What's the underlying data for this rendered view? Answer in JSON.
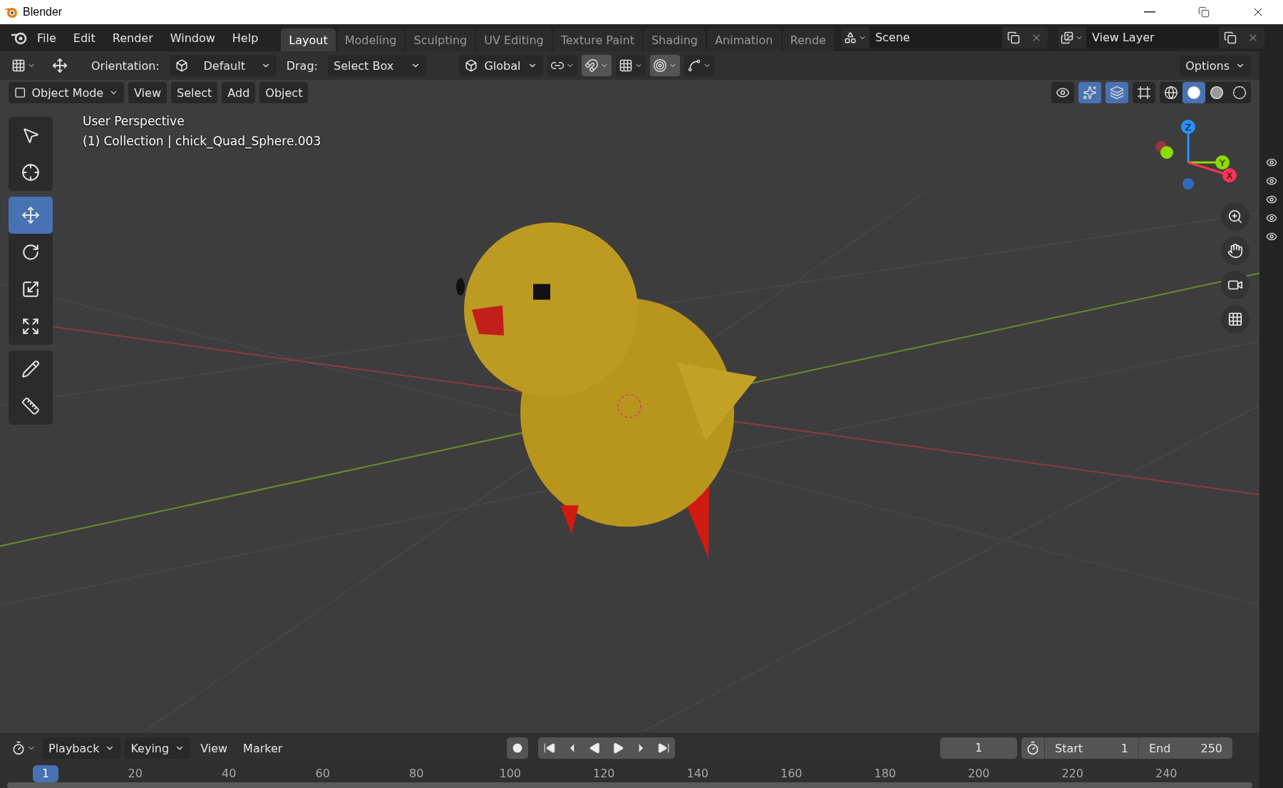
{
  "app_title": "Blender",
  "window_controls": [
    {
      "kind": "minimize"
    },
    {
      "kind": "restore"
    },
    {
      "kind": "close"
    }
  ],
  "menu": [
    "File",
    "Edit",
    "Render",
    "Window",
    "Help"
  ],
  "workspaces": [
    {
      "label": "Layout",
      "selected": true
    },
    {
      "label": "Modeling",
      "selected": false
    },
    {
      "label": "Sculpting",
      "selected": false
    },
    {
      "label": "UV Editing",
      "selected": false
    },
    {
      "label": "Texture Paint",
      "selected": false
    },
    {
      "label": "Shading",
      "selected": false
    },
    {
      "label": "Animation",
      "selected": false
    },
    {
      "label": "Rende",
      "selected": false
    }
  ],
  "scene": {
    "value": "Scene"
  },
  "view_layer": {
    "value": "View Layer"
  },
  "tool_header": {
    "orientation_label": "Orientation:",
    "orientation": "Default",
    "drag_label": "Drag:",
    "drag": "Select Box",
    "transform": "Global",
    "options": "Options",
    "toggles": [
      {
        "kind": "pivot",
        "on": false
      },
      {
        "kind": "snap",
        "on": true
      },
      {
        "kind": "snap-target",
        "on": false
      },
      {
        "kind": "proportional",
        "on": true
      },
      {
        "kind": "falloff",
        "on": false
      }
    ]
  },
  "viewport_header": {
    "mode": "Object Mode",
    "menus": [
      "View",
      "Select",
      "Add",
      "Object"
    ],
    "toggles": [
      {
        "kind": "visibility",
        "on": false
      },
      {
        "kind": "gizmo",
        "on": true
      },
      {
        "kind": "overlay",
        "on": true
      },
      {
        "kind": "xray",
        "on": false
      }
    ],
    "shading": [
      {
        "kind": "wireframe",
        "selected": false
      },
      {
        "kind": "solid",
        "selected": true
      },
      {
        "kind": "material",
        "selected": false
      },
      {
        "kind": "rendered",
        "selected": false
      }
    ]
  },
  "tools": [
    [
      {
        "kind": "select-box",
        "selected": false
      },
      {
        "kind": "cursor",
        "selected": false
      }
    ],
    [
      {
        "kind": "move",
        "selected": true
      },
      {
        "kind": "rotate",
        "selected": false
      },
      {
        "kind": "scale",
        "selected": false
      },
      {
        "kind": "transform",
        "selected": false
      }
    ],
    [
      {
        "kind": "annotate",
        "selected": false
      },
      {
        "kind": "measure",
        "selected": false
      }
    ]
  ],
  "viewport": {
    "view_name": "User Perspective",
    "object_info": "(1) Collection | chick_Quad_Sphere.003"
  },
  "gizmo": {
    "axes": [
      {
        "kind": "z",
        "label": "Z"
      },
      {
        "kind": "y",
        "label": "Y"
      },
      {
        "kind": "x",
        "label": "X"
      }
    ]
  },
  "navigation": [
    {
      "kind": "zoom"
    },
    {
      "kind": "pan"
    },
    {
      "kind": "camera"
    },
    {
      "kind": "ortho"
    }
  ],
  "timeline": {
    "menus": [
      {
        "label": "Playback",
        "dropdown": true
      },
      {
        "label": "Keying",
        "dropdown": true
      },
      {
        "label": "View",
        "dropdown": false
      },
      {
        "label": "Marker",
        "dropdown": false
      }
    ],
    "transport": [
      {
        "kind": "record"
      },
      {
        "kind": "jump-start"
      },
      {
        "kind": "prev-key"
      },
      {
        "kind": "play-reverse"
      },
      {
        "kind": "play"
      },
      {
        "kind": "next-key"
      },
      {
        "kind": "jump-end"
      }
    ],
    "current_frame": "1",
    "start_label": "Start",
    "start": "1",
    "end_label": "End",
    "end": "250",
    "playhead": "1",
    "ticks": [
      "20",
      "40",
      "60",
      "80",
      "100",
      "120",
      "140",
      "160",
      "180",
      "200",
      "220",
      "240"
    ]
  }
}
